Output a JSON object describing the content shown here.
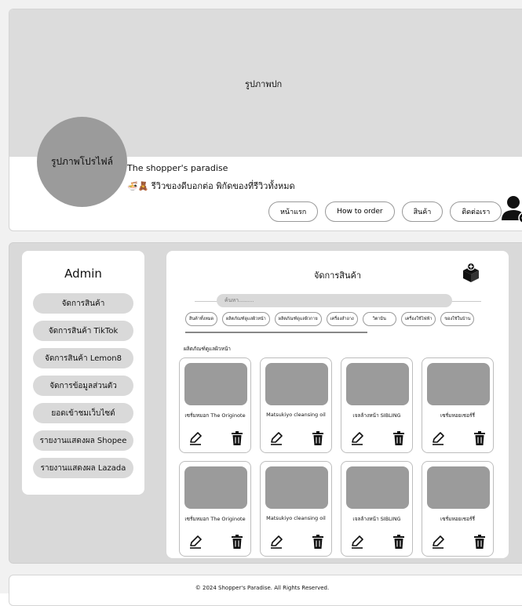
{
  "header": {
    "cover_label": "รูปภาพปก",
    "avatar_label": "รูปภาพโปรไฟล์",
    "shop_name": "The shopper's paradise",
    "shop_desc": "🍜🧸 รีวิวของดีบอกต่อ พิกัดของที่รีวิวทั้งหมด",
    "nav": [
      "หน้าแรก",
      "How to order",
      "สินค้า",
      "ติดต่อเรา"
    ],
    "user_icon": "add-user-icon"
  },
  "sidebar": {
    "title": "Admin",
    "items": [
      "จัดการสินค้า",
      "จัดการสินค้า TikTok",
      "จัดการสินค้า Lemon8",
      "จัดการข้อมูลส่วนตัว",
      "ยอดเข้าชมเว็บไซต์",
      "รายงานแสดงผล Shopee",
      "รายงานแสดงผล Lazada"
    ]
  },
  "panel": {
    "title": "จัดการสินค้า",
    "box_icon": "add-box-icon",
    "search_placeholder": "ค้นหา..........",
    "categories": [
      "สินค้าทั้งหมด",
      "ผลิตภัณฑ์ดูแลผิวหน้า",
      "ผลิตภัณฑ์ดูแลผิวกาย",
      "เครื่องสำอาง",
      "วิตามิน",
      "เครื่องใช้ไฟฟ้า",
      "ของใช้ในบ้าน"
    ],
    "section_label": "ผลิตภัณฑ์ดูแลผิวหน้า",
    "products": [
      {
        "name": "เซรั่มหมอก The Originote"
      },
      {
        "name": "Matsukiyo cleansing oil"
      },
      {
        "name": "เจลล้างหน้า SIBLING"
      },
      {
        "name": "เซรั่มหอยเชอร์รี่"
      },
      {
        "name": "เซรั่มหมอก The Originote"
      },
      {
        "name": "Matsukiyo cleansing oil"
      },
      {
        "name": "เจลล้างหน้า SIBLING"
      },
      {
        "name": "เซรั่มหอยเชอร์รี่"
      }
    ]
  },
  "footer": {
    "text": "© 2024 Shopper's Paradise. All Rights Reserved."
  }
}
